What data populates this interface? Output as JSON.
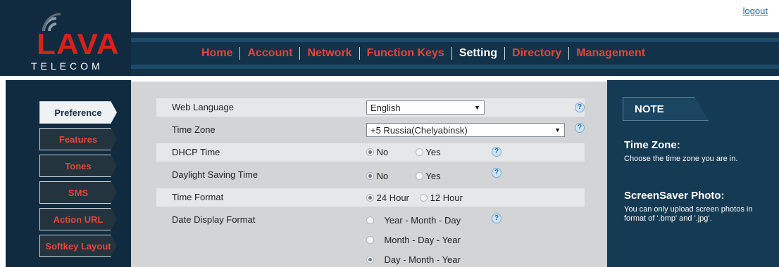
{
  "header": {
    "logo_main": "LAVA",
    "logo_sub": "TELECOM",
    "logout_label": "logout"
  },
  "nav": {
    "items": [
      {
        "label": "Home",
        "active": false
      },
      {
        "label": "Account",
        "active": false
      },
      {
        "label": "Network",
        "active": false
      },
      {
        "label": "Function Keys",
        "active": false
      },
      {
        "label": "Setting",
        "active": true
      },
      {
        "label": "Directory",
        "active": false
      },
      {
        "label": "Management",
        "active": false
      }
    ]
  },
  "sidebar": {
    "items": [
      {
        "label": "Preference",
        "active": true
      },
      {
        "label": "Features",
        "active": false
      },
      {
        "label": "Tones",
        "active": false
      },
      {
        "label": "SMS",
        "active": false
      },
      {
        "label": "Action URL",
        "active": false
      },
      {
        "label": "Softkey Layout",
        "active": false
      }
    ]
  },
  "settings": {
    "web_language": {
      "label": "Web Language",
      "value": "English"
    },
    "time_zone": {
      "label": "Time Zone",
      "value": "+5 Russia(Chelyabinsk)"
    },
    "dhcp_time": {
      "label": "DHCP Time",
      "options": [
        "No",
        "Yes"
      ],
      "selected": "No"
    },
    "daylight_saving": {
      "label": "Daylight Saving Time",
      "options": [
        "No",
        "Yes"
      ],
      "selected": "No"
    },
    "time_format": {
      "label": "Time Format",
      "options": [
        "24 Hour",
        "12 Hour"
      ],
      "selected": "24 Hour"
    },
    "date_display_format": {
      "label": "Date Display Format",
      "options": [
        "Year - Month - Day",
        "Month - Day - Year",
        "Day - Month - Year"
      ],
      "selected": "Day - Month - Year"
    },
    "help_glyph": "?"
  },
  "note": {
    "tab_label": "NOTE",
    "sections": [
      {
        "title": "Time Zone:",
        "text": "Choose the time zone you are in."
      },
      {
        "title": "ScreenSaver Photo:",
        "text": "You can only upload screen photos in format of '.bmp' and '.jpg'."
      }
    ]
  },
  "colors": {
    "brand_red": "#d8211b",
    "nav_bg": "#12324a",
    "panel_dark": "#102b3f",
    "content_bg": "#d2d4d6",
    "note_bg": "#153a54"
  },
  "icons": {
    "help": "help-icon",
    "logo_waves": "signal-waves-icon"
  }
}
